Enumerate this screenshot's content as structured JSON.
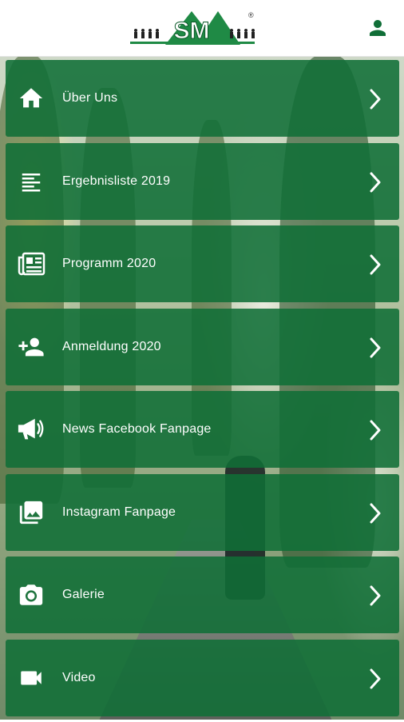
{
  "header": {
    "logo_text": "SM",
    "registered_mark": "®"
  },
  "colors": {
    "accent": "#106e37",
    "text_on_accent": "#ffffff",
    "header_bg": "#ffffff"
  },
  "menu": {
    "items": [
      {
        "label": "Über Uns",
        "icon": "home-icon"
      },
      {
        "label": "Ergebnisliste 2019",
        "icon": "list-icon"
      },
      {
        "label": "Programm 2020",
        "icon": "newspaper-icon"
      },
      {
        "label": "Anmeldung 2020",
        "icon": "add-person-icon"
      },
      {
        "label": "News Facebook Fanpage",
        "icon": "megaphone-icon"
      },
      {
        "label": "Instagram Fanpage",
        "icon": "photo-library-icon"
      },
      {
        "label": "Galerie",
        "icon": "camera-icon"
      },
      {
        "label": "Video",
        "icon": "videocam-icon"
      }
    ]
  }
}
